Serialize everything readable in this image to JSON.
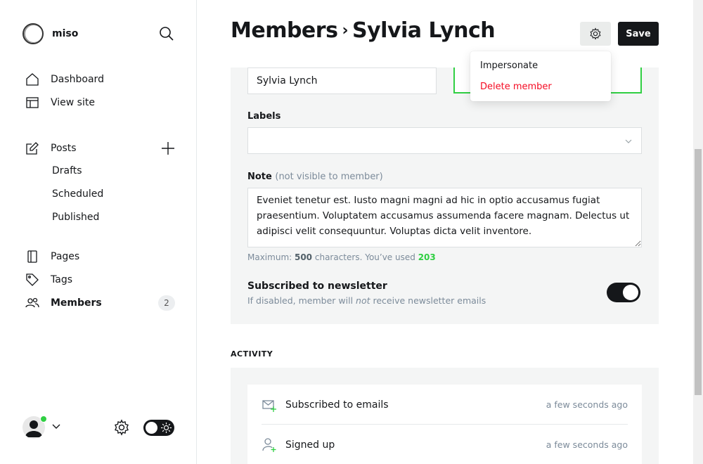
{
  "sidebar": {
    "brand": "miso",
    "nav": {
      "dashboard": "Dashboard",
      "view_site": "View site",
      "posts": "Posts",
      "drafts": "Drafts",
      "scheduled": "Scheduled",
      "published": "Published",
      "pages": "Pages",
      "tags": "Tags",
      "members": "Members",
      "members_count": "2"
    },
    "online_color": "#30cf43"
  },
  "header": {
    "breadcrumb_parent": "Members",
    "separator": "›",
    "title": "Sylvia Lynch",
    "save_label": "Save"
  },
  "menu": {
    "impersonate": "Impersonate",
    "delete_member": "Delete member"
  },
  "form": {
    "name_value": "Sylvia Lynch",
    "labels_label": "Labels",
    "note_label": "Note",
    "note_hint": "(not visible to member)",
    "note_value": "Eveniet tenetur est. Iusto magni magni ad hic in optio accusamus fugiat praesentium. Voluptatem accusamus assumenda facere magnam. Delectus ut adipisci velit consequuntur. Voluptas dicta velit inventore.",
    "char_prefix": "Maximum: ",
    "char_max": "500",
    "char_mid": " characters. You’ve used ",
    "char_used": "203",
    "newsletter_title": "Subscribed to newsletter",
    "newsletter_desc_pre": "If disabled, member will ",
    "newsletter_desc_em": "not",
    "newsletter_desc_post": " receive newsletter emails",
    "newsletter_enabled": true
  },
  "activity": {
    "heading": "ACTIVITY",
    "items": [
      {
        "text": "Subscribed to emails",
        "time": "a few seconds ago",
        "icon": "envelope-plus-icon"
      },
      {
        "text": "Signed up",
        "time": "a few seconds ago",
        "icon": "user-plus-icon"
      }
    ]
  },
  "colors": {
    "accent_green": "#30cf43",
    "danger_red": "#f50b23",
    "dark": "#15171a"
  }
}
